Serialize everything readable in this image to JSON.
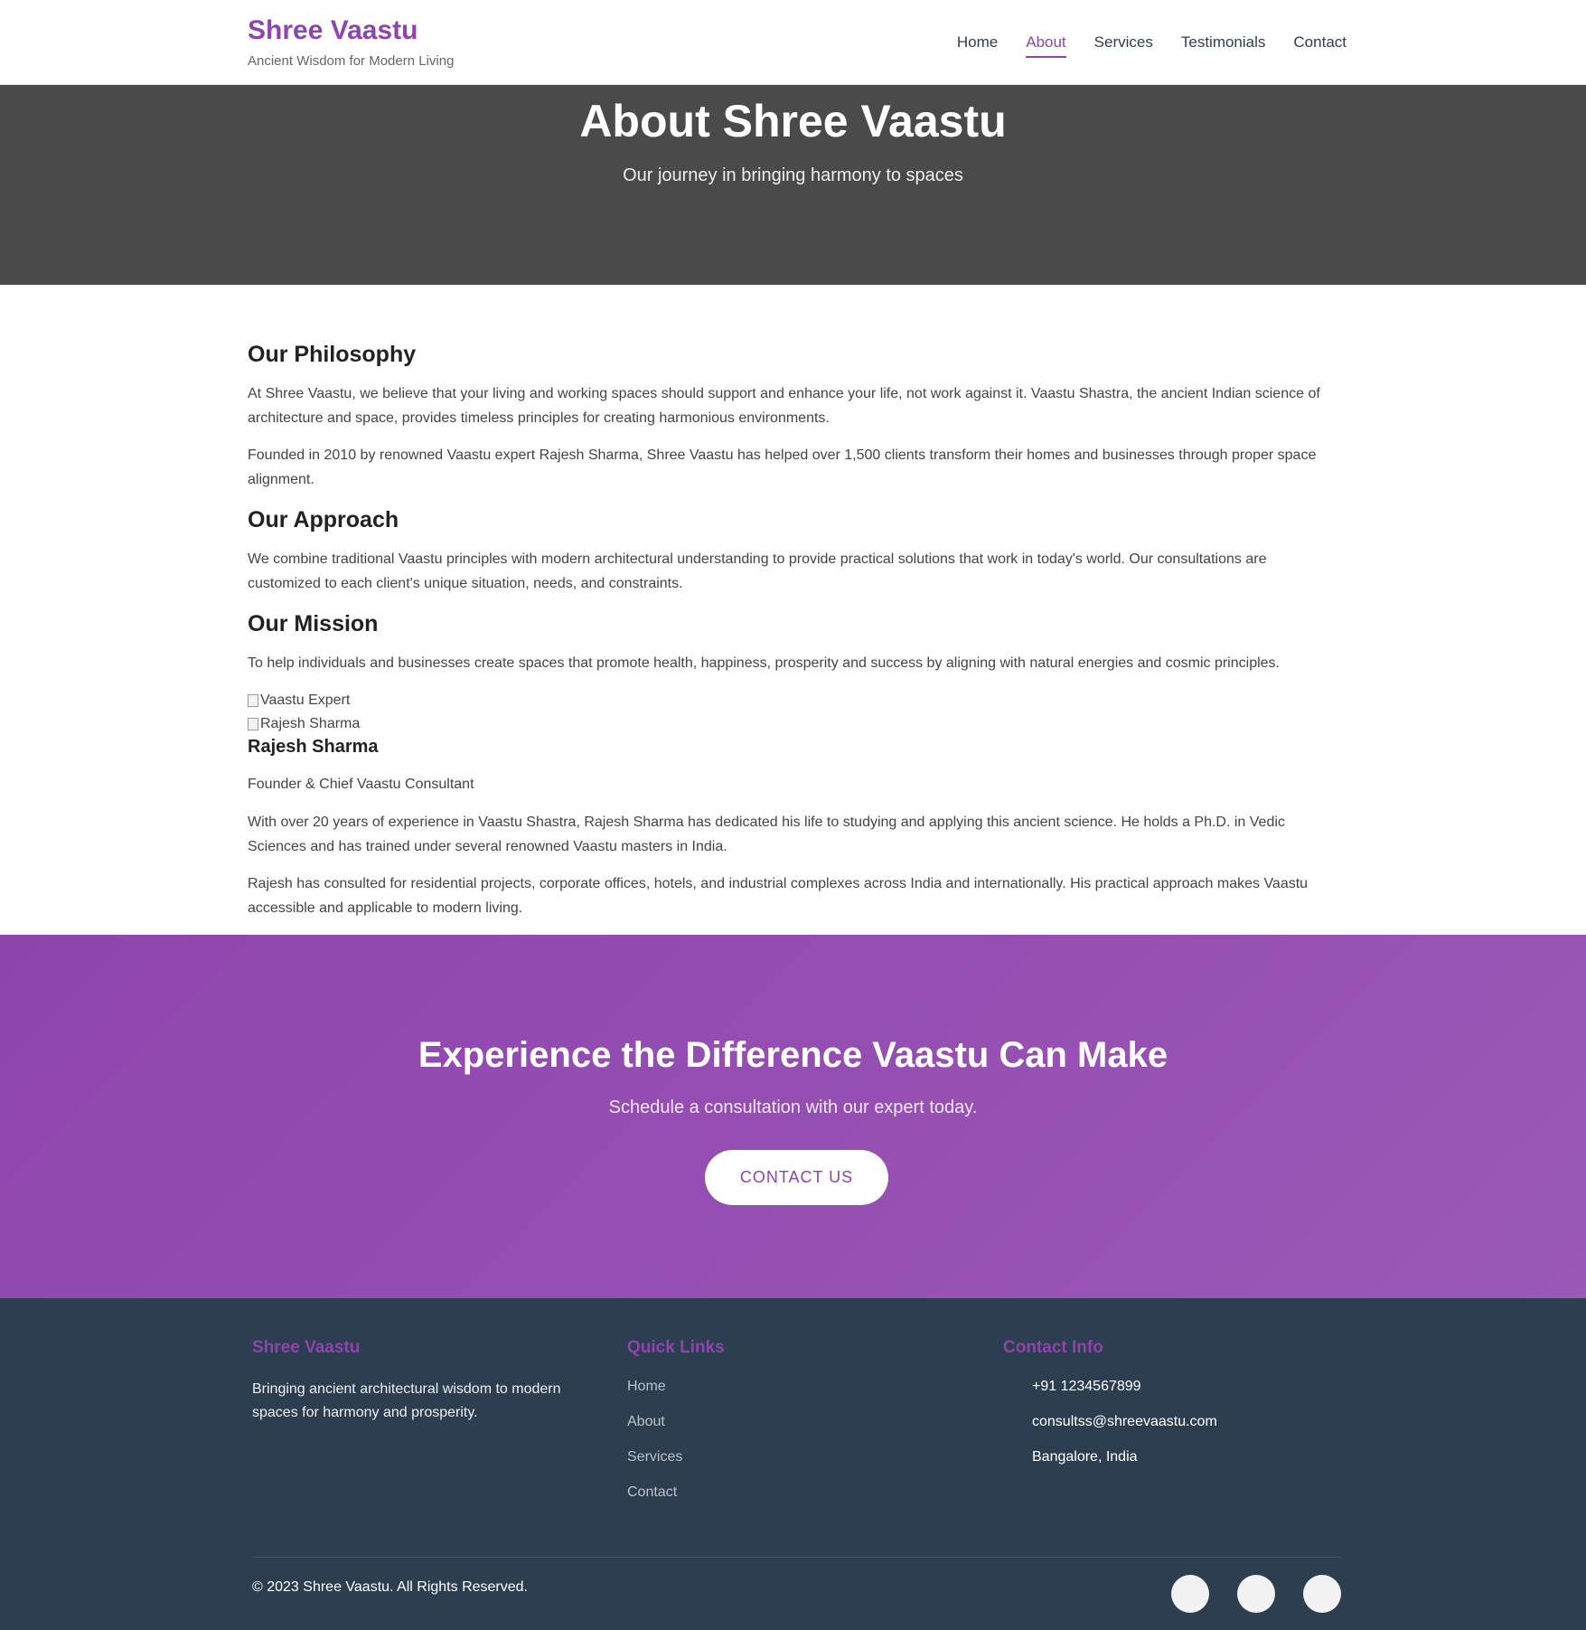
{
  "header": {
    "brand_name": "Shree Vaastu",
    "brand_tagline": "Ancient Wisdom for Modern Living",
    "nav": [
      "Home",
      "About",
      "Services",
      "Testimonials",
      "Contact"
    ],
    "active_nav": "About"
  },
  "hero": {
    "title": "About Shree Vaastu",
    "subtitle": "Our journey in bringing harmony to spaces"
  },
  "content": {
    "philosophy_heading": "Our Philosophy",
    "philosophy_p1": "At Shree Vaastu, we believe that your living and working spaces should support and enhance your life, not work against it. Vaastu Shastra, the ancient Indian science of architecture and space, provides timeless principles for creating harmonious environments.",
    "philosophy_p2": "Founded in 2010 by renowned Vaastu expert Rajesh Sharma, Shree Vaastu has helped over 1,500 clients transform their homes and businesses through proper space alignment.",
    "approach_heading": "Our Approach",
    "approach_p1": "We combine traditional Vaastu principles with modern architectural understanding to provide practical solutions that work in today's world. Our consultations are customized to each client's unique situation, needs, and constraints.",
    "mission_heading": "Our Mission",
    "mission_p1": "To help individuals and businesses create spaces that promote health, happiness, prosperity and success by aligning with natural energies and cosmic principles.",
    "image_alt_1": "Vaastu Expert",
    "image_alt_2": "Rajesh Sharma",
    "founder_name": "Rajesh Sharma",
    "founder_role": "Founder & Chief Vaastu Consultant",
    "founder_p1": "With over 20 years of experience in Vaastu Shastra, Rajesh Sharma has dedicated his life to studying and applying this ancient science. He holds a Ph.D. in Vedic Sciences and has trained under several renowned Vaastu masters in India.",
    "founder_p2": "Rajesh has consulted for residential projects, corporate offices, hotels, and industrial complexes across India and internationally. His practical approach makes Vaastu accessible and applicable to modern living."
  },
  "cta": {
    "title": "Experience the Difference Vaastu Can Make",
    "subtitle": "Schedule a consultation with our expert today.",
    "button": "CONTACT US"
  },
  "footer": {
    "brand_heading": "Shree Vaastu",
    "brand_desc": "Bringing ancient architectural wisdom to modern spaces for harmony and prosperity.",
    "links_heading": "Quick Links",
    "links": [
      "Home",
      "About",
      "Services",
      "Contact"
    ],
    "contact_heading": "Contact Info",
    "contact": [
      "+91 1234567899",
      "consultss@shreevaastu.com",
      "Bangalore, India"
    ],
    "copyright": "© 2023 Shree Vaastu. All Rights Reserved.",
    "social_icons": [
      "social-icon-1",
      "social-icon-2",
      "social-icon-3"
    ]
  },
  "colors": {
    "brand_purple": "#8e44ad",
    "hero_bg": "#4a4a4a",
    "footer_bg": "#2c3e50"
  }
}
